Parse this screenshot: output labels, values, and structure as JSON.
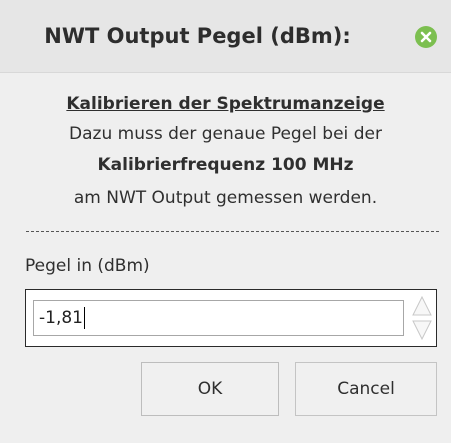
{
  "dialog": {
    "title": "NWT Output Pegel (dBm):",
    "close_icon": "close-icon",
    "accent_color": "#7cbf50"
  },
  "info": {
    "heading": "Kalibrieren der Spektrumanzeige",
    "line2": "Dazu muss der genaue Pegel bei der",
    "line3": "Kalibrierfrequenz 100 MHz",
    "line4": "am NWT Output gemessen werden.",
    "divider": "-----------------------------------------------------------"
  },
  "field": {
    "label": "Pegel in (dBm)",
    "value": "-1,81"
  },
  "buttons": {
    "ok": "OK",
    "cancel": "Cancel"
  }
}
